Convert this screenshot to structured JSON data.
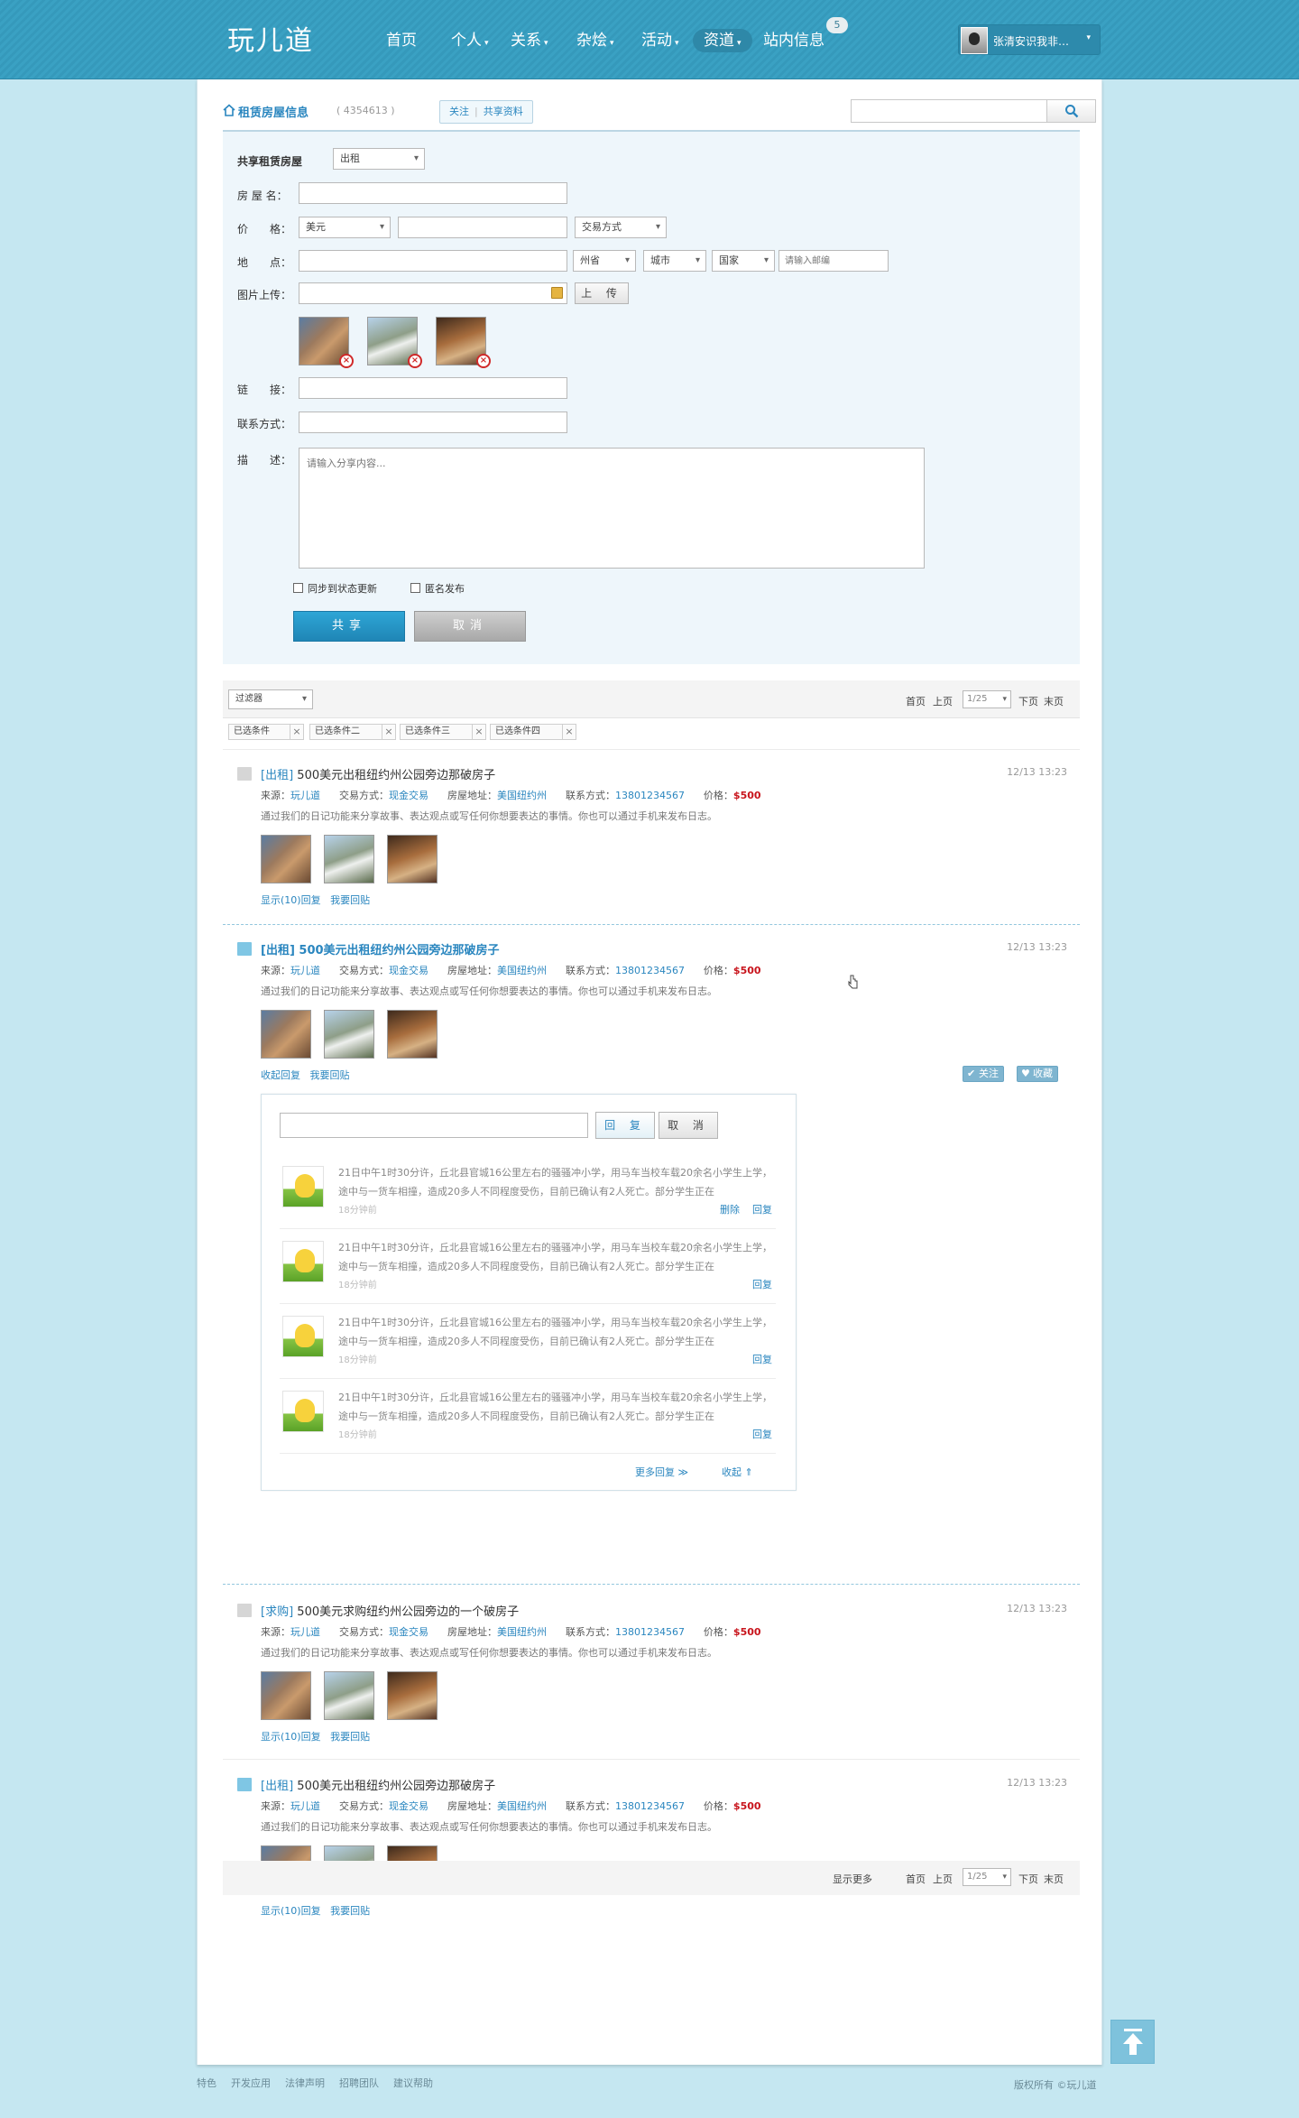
{
  "nav": {
    "logo": "玩儿道",
    "items": [
      {
        "label": "首页",
        "caret": false
      },
      {
        "label": "个人",
        "caret": true
      },
      {
        "label": "关系",
        "caret": true
      },
      {
        "label": "杂烩",
        "caret": true
      },
      {
        "label": "活动",
        "caret": true
      },
      {
        "label": "资道",
        "caret": true
      },
      {
        "label": "站内信息",
        "caret": false
      }
    ],
    "active_item": "资道",
    "message_count": "5",
    "user_name": "张清安识我非…"
  },
  "header": {
    "title": "租赁房屋信息",
    "id_text": "( 4354613 )",
    "links": [
      "关注",
      "共享资料"
    ],
    "search_value": ""
  },
  "form": {
    "share_label": "共享租赁房屋",
    "share_type": "出租",
    "house_name_label": "房 屋 名：",
    "price_label": "价　　格：",
    "currency": "美元",
    "trade_select": "交易方式",
    "location_label": "地　　点：",
    "province": "州省",
    "city": "城市",
    "country": "国家",
    "zip_placeholder": "请输入邮编",
    "upload_label": "图片上传：",
    "upload_button": "上 传",
    "link_label": "链　　接：",
    "contact_label": "联系方式：",
    "desc_label": "描　　述：",
    "desc_placeholder": "请输入分享内容...",
    "sync_label": "同步到状态更新",
    "anon_label": "匿名发布",
    "submit_label": "共享",
    "cancel_label": "取消"
  },
  "filter": {
    "select": "过滤器",
    "tags": [
      "已选条件",
      "已选条件二",
      "已选条件三",
      "已选条件四"
    ],
    "pager": {
      "first": "首页",
      "prev": "上页",
      "page": "1/25",
      "next": "下页",
      "last": "末页"
    }
  },
  "posts": [
    {
      "kind": "[出租]",
      "title": "500美元出租纽约州公园旁边那破房子",
      "time": "12/13 13:23",
      "source_label": "来源：",
      "source": "玩儿道",
      "trade_label": "交易方式：",
      "trade": "现金交易",
      "addr_label": "房屋地址：",
      "addr": "美国纽约州",
      "contact_label": "联系方式：",
      "contact": "13801234567",
      "price_label": "价格：",
      "price": "$500",
      "desc": "通过我们的日记功能来分享故事、表达观点或写任何你想要表达的事情。你也可以通过手机来发布日志。",
      "link1": "显示(10)回复",
      "link2": "我要回贴"
    },
    {
      "kind": "[出租]",
      "title": "500美元出租纽约州公园旁边那破房子",
      "time": "12/13 13:23",
      "source_label": "来源：",
      "source": "玩儿道",
      "trade_label": "交易方式：",
      "trade": "现金交易",
      "addr_label": "房屋地址：",
      "addr": "美国纽约州",
      "contact_label": "联系方式：",
      "contact": "13801234567",
      "price_label": "价格：",
      "price": "$500",
      "desc": "通过我们的日记功能来分享故事、表达观点或写任何你想要表达的事情。你也可以通过手机来发布日志。",
      "link1": "收起回复",
      "link2": "我要回贴",
      "follow": "关注",
      "collect": "收藏"
    },
    {
      "kind": "[求购]",
      "title": "500美元求购纽约州公园旁边的一个破房子",
      "time": "12/13 13:23",
      "source_label": "来源：",
      "source": "玩儿道",
      "trade_label": "交易方式：",
      "trade": "现金交易",
      "addr_label": "房屋地址：",
      "addr": "美国纽约州",
      "contact_label": "联系方式：",
      "contact": "13801234567",
      "price_label": "价格：",
      "price": "$500",
      "desc": "通过我们的日记功能来分享故事、表达观点或写任何你想要表达的事情。你也可以通过手机来发布日志。",
      "link1": "显示(10)回复",
      "link2": "我要回贴"
    },
    {
      "kind": "[出租]",
      "title": "500美元出租纽约州公园旁边那破房子",
      "time": "12/13 13:23",
      "source_label": "来源：",
      "source": "玩儿道",
      "trade_label": "交易方式：",
      "trade": "现金交易",
      "addr_label": "房屋地址：",
      "addr": "美国纽约州",
      "contact_label": "联系方式：",
      "contact": "13801234567",
      "price_label": "价格：",
      "price": "$500",
      "desc": "通过我们的日记功能来分享故事、表达观点或写任何你想要表达的事情。你也可以通过手机来发布日志。",
      "link1": "显示(10)回复",
      "link2": "我要回贴"
    }
  ],
  "reply": {
    "input_value": "",
    "reply_button": "回 复",
    "cancel_button": "取 消",
    "items": [
      {
        "text": "21日中午1时30分许，丘北县官城16公里左右的骚骚冲小学，用马车当校车载20余名小学生上学，途中与一货车相撞，造成20多人不同程度受伤，目前已确认有2人死亡。部分学生正在",
        "time": "18分钟前",
        "delete": "删除",
        "reply": "回复"
      },
      {
        "text": "21日中午1时30分许，丘北县官城16公里左右的骚骚冲小学，用马车当校车载20余名小学生上学，途中与一货车相撞，造成20多人不同程度受伤，目前已确认有2人死亡。部分学生正在",
        "time": "18分钟前",
        "reply": "回复"
      },
      {
        "text": "21日中午1时30分许，丘北县官城16公里左右的骚骚冲小学，用马车当校车载20余名小学生上学，途中与一货车相撞，造成20多人不同程度受伤，目前已确认有2人死亡。部分学生正在",
        "time": "18分钟前",
        "reply": "回复"
      },
      {
        "text": "21日中午1时30分许，丘北县官城16公里左右的骚骚冲小学，用马车当校车载20余名小学生上学，途中与一货车相撞，造成20多人不同程度受伤，目前已确认有2人死亡。部分学生正在",
        "time": "18分钟前",
        "reply": "回复"
      }
    ],
    "more": "更多回复 ≫",
    "collapse": "收起 ⇑"
  },
  "bottom": {
    "show_more": "显示更多",
    "pager": {
      "first": "首页",
      "prev": "上页",
      "page": "1/25",
      "next": "下页",
      "last": "末页"
    }
  },
  "footer": {
    "links": [
      "特色",
      "开发应用",
      "法律声明",
      "招聘团队",
      "建议帮助"
    ],
    "copyright": "版权所有 ©玩儿道"
  }
}
